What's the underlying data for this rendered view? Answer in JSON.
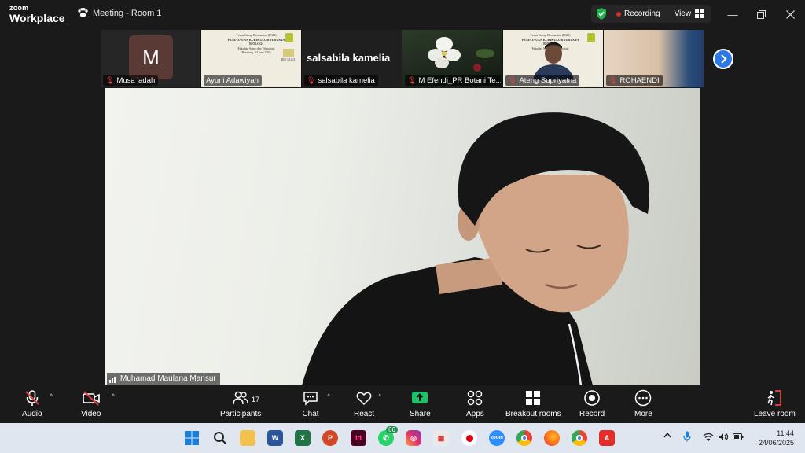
{
  "app": {
    "brand_top": "zoom",
    "brand_bottom": "Workplace",
    "meeting_title": "Meeting - Room 1"
  },
  "recording": {
    "label": "Recording",
    "view_label": "View"
  },
  "participants_strip": [
    {
      "name": "Musa 'adah",
      "avatar_letter": "M",
      "muted": true
    },
    {
      "name": "Ayuni Adawiyah",
      "muted": false
    },
    {
      "name": "salsabila kamelia",
      "display_text": "salsabila kamelia",
      "muted": true
    },
    {
      "name": "M Efendi_PR Botani Te...",
      "muted": true
    },
    {
      "name": "Ateng Supriyatna",
      "muted": true
    },
    {
      "name": "ROHAENDI",
      "muted": true
    }
  ],
  "slide_text": {
    "line1": "Focus Group Discussion (FGD)",
    "line2": "PENINJAUAN KURIKULUM JURUSAN BIOLOGI",
    "line3": "Fakultas Sains dan Teknologi",
    "line4": "Bandung, 24 Juni 2025",
    "logo_text": "BIO LOGI"
  },
  "main_speaker": {
    "name": "Muhamad Maulana Mansur"
  },
  "toolbar": {
    "audio": "Audio",
    "video": "Video",
    "participants": "Participants",
    "participants_count": "17",
    "chat": "Chat",
    "react": "React",
    "share": "Share",
    "apps": "Apps",
    "breakout": "Breakout rooms",
    "record": "Record",
    "more": "More",
    "leave": "Leave room"
  },
  "taskbar": {
    "whatsapp_badge": "66",
    "time": "11:44",
    "date": "24/06/2025",
    "icons": [
      "start-icon",
      "search-icon",
      "file-explorer-icon",
      "word-icon",
      "excel-icon",
      "powerpoint-icon",
      "indesign-icon",
      "whatsapp-icon",
      "instagram-icon",
      "app-icon",
      "record-icon",
      "zoom-icon",
      "chrome-icon",
      "firefox-icon",
      "chrome-profile-icon",
      "acrobat-icon"
    ]
  },
  "colors": {
    "accent_blue": "#2d7ae5",
    "record_red": "#e02828",
    "share_green": "#1fc26b",
    "mute_red": "#e34343"
  }
}
